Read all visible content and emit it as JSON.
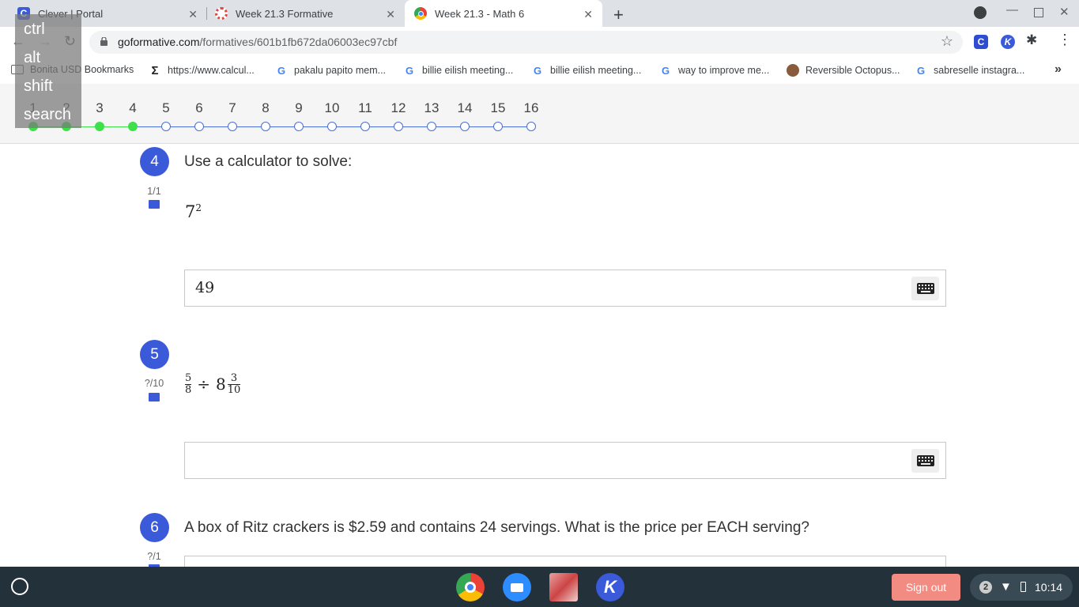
{
  "browser": {
    "tabs": [
      {
        "title": "Clever | Portal",
        "favicon_color": "#3b5bdb"
      },
      {
        "title": "Week 21.3 Formative",
        "favicon_color": "#e8453c"
      },
      {
        "title": "Week 21.3 - Math 6",
        "favicon_color": "#4285f4",
        "active": true
      }
    ],
    "close_glyph": "✕",
    "new_tab_glyph": "+",
    "url_domain": "goformative.com",
    "url_path": "/formatives/601b1fb672da06003ec97cbf",
    "extensions": [
      {
        "letter": "C",
        "color": "#2f4dd3"
      },
      {
        "letter": "K",
        "color": "#3b5ad9"
      }
    ]
  },
  "bookmarks": [
    {
      "label": "Bonita USD Bookmarks",
      "icon": "folder-icon"
    },
    {
      "label": "https://www.calcul...",
      "icon": "sigma-icon"
    },
    {
      "label": "pakalu papito mem...",
      "icon": "google-icon"
    },
    {
      "label": "billie eilish meeting...",
      "icon": "google-icon"
    },
    {
      "label": "billie eilish meeting...",
      "icon": "google-icon"
    },
    {
      "label": "way to improve me...",
      "icon": "google-icon"
    },
    {
      "label": "Reversible Octopus...",
      "icon": "octopus-icon"
    },
    {
      "label": "sabreselle instagra...",
      "icon": "google-icon"
    }
  ],
  "bookmarks_overflow": "»",
  "progress": {
    "questions": [
      "1",
      "2",
      "3",
      "4",
      "5",
      "6",
      "7",
      "8",
      "9",
      "10",
      "11",
      "12",
      "13",
      "14",
      "15",
      "16"
    ],
    "answered_count": 4
  },
  "keyboard_overlay": [
    "ctrl",
    "alt",
    "shift",
    "search"
  ],
  "questions": [
    {
      "number": "4",
      "score": "1/1",
      "prompt": "Use a calculator to solve:",
      "base": "7",
      "exponent": "2",
      "answer": "49"
    },
    {
      "number": "5",
      "score": "?/10",
      "prompt": "",
      "frac1_num": "5",
      "frac1_den": "8",
      "operator": "÷",
      "whole": "8",
      "frac2_num": "3",
      "frac2_den": "10",
      "answer": ""
    },
    {
      "number": "6",
      "score": "?/1",
      "prompt": "A box of Ritz crackers is $2.59 and contains 24 servings.  What is the price per EACH serving?"
    }
  ],
  "shelf": {
    "sign_out": "Sign out",
    "notification_count": "2",
    "time": "10:14"
  },
  "colors": {
    "accent": "#3b5ad9",
    "answered": "#3ee04a",
    "shelf": "#22313a",
    "sign_out": "#f28b82"
  }
}
